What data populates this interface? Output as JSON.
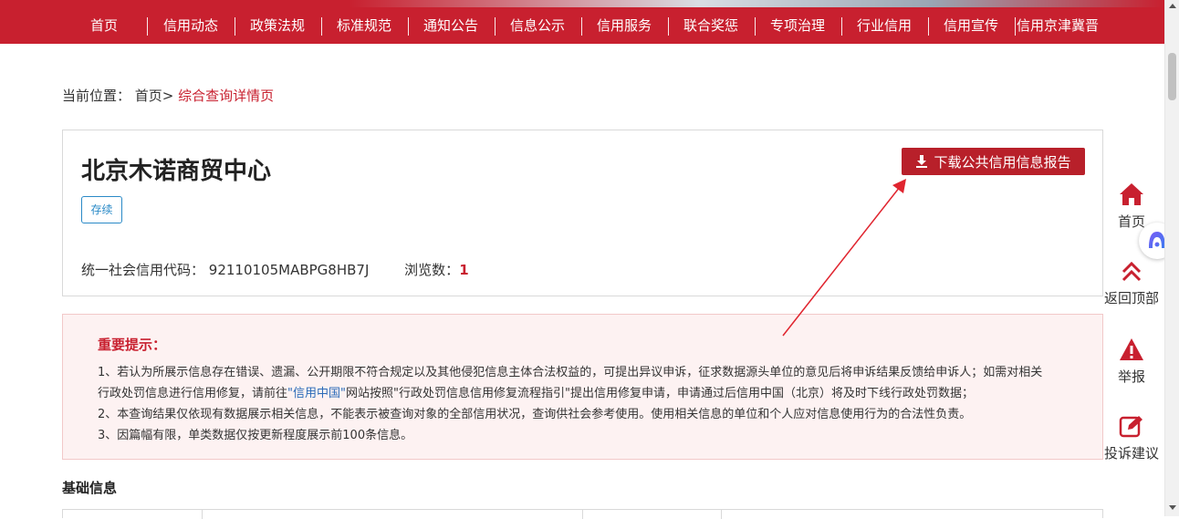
{
  "nav": {
    "items": [
      "首页",
      "信用动态",
      "政策法规",
      "标准规范",
      "通知公告",
      "信息公示",
      "信用服务",
      "联合奖惩",
      "专项治理",
      "行业信用",
      "信用宣传",
      "信用京津冀晋"
    ]
  },
  "breadcrumb": {
    "prefix": "当前位置：",
    "home": "首页>",
    "current": "综合查询详情页"
  },
  "company": {
    "name": "北京木诺商贸中心",
    "status": "存续",
    "code_label": "统一社会信用代码：",
    "code": "92110105MABPG8HB7J",
    "views_label": "浏览数：",
    "views": "1",
    "download_label": "下载公共信用信息报告"
  },
  "notice": {
    "title": "重要提示：",
    "line1a": "1、若认为所展示信息存在错误、遗漏、公开期限不符合规定以及其他侵犯信息主体合法权益的，可提出异议申诉，征求数据源头单位的意见后将申诉结果反馈给申诉人；如需对相关",
    "line1b": "行政处罚信息进行信用修复，请前往",
    "line1_link": "\"信用中国\"",
    "line1c": "网站按照\"行政处罚信息信用修复流程指引\"提出信用修复申请，申请通过后信用中国（北京）将及时下线行政处罚数据；",
    "line2": "2、本查询结果仅依现有数据展示相关信息，不能表示被查询对象的全部信用状况，查询供社会参考使用。使用相关信息的单位和个人应对信息使用行为的合法性负责。",
    "line3": "3、因篇幅有限，单类数据仅按更新程度展示前100条信息。"
  },
  "section": {
    "basic_info": "基础信息"
  },
  "side": {
    "home": "首页",
    "top": "返回顶部",
    "report": "举报",
    "complaint": "投诉建议"
  },
  "colors": {
    "brand_red": "#c8202f",
    "link_blue": "#2a6ab8",
    "status_blue": "#2a8ac7"
  }
}
